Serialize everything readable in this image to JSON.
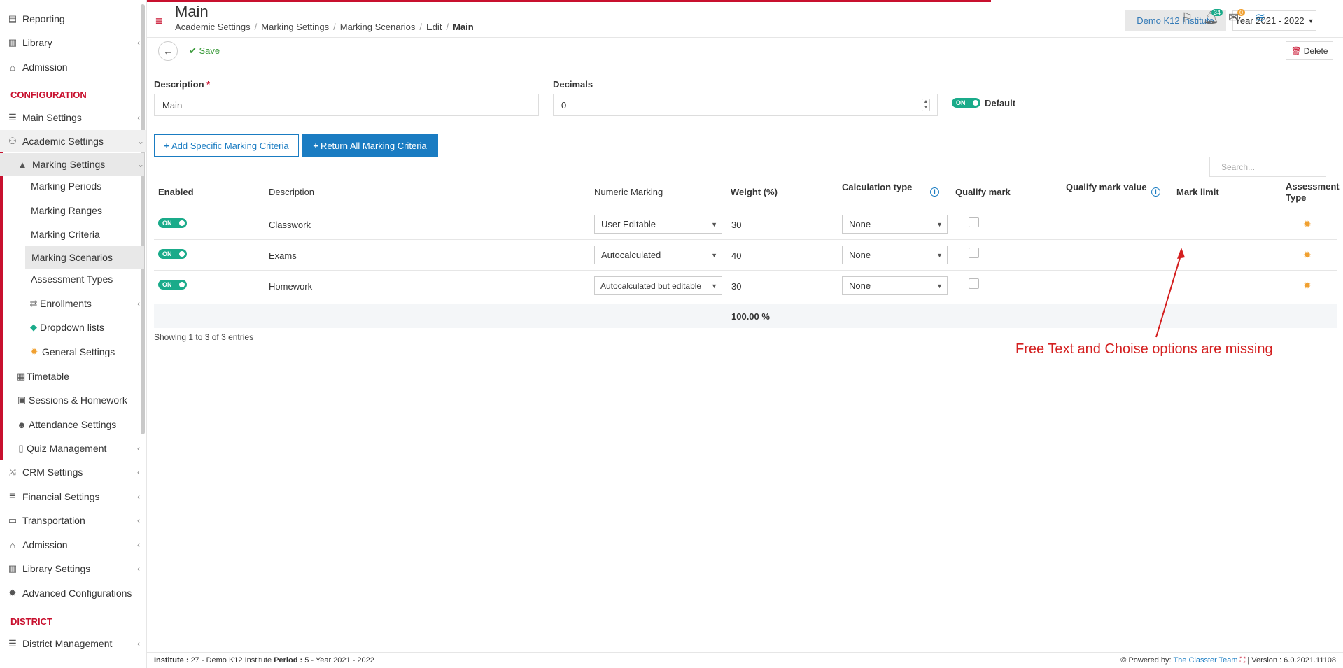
{
  "sidebar": {
    "items": [
      {
        "label": "Reporting",
        "icon": "printer-icon"
      },
      {
        "label": "Library",
        "icon": "books-icon"
      },
      {
        "label": "Admission",
        "icon": "bank-icon"
      },
      {
        "label": "Main Settings",
        "icon": "sliders-icon"
      },
      {
        "label": "Academic Settings",
        "icon": "users-icon"
      },
      {
        "label": "Marking Settings",
        "icon": "graduation-cap-icon"
      },
      {
        "label": "Marking Periods"
      },
      {
        "label": "Marking Ranges"
      },
      {
        "label": "Marking Criteria"
      },
      {
        "label": "Marking Scenarios"
      },
      {
        "label": "Assessment Types"
      },
      {
        "label": "Enrollments",
        "icon": "exchange-icon"
      },
      {
        "label": "Dropdown lists",
        "icon": "layers-icon"
      },
      {
        "label": "General Settings",
        "icon": "gears-icon"
      },
      {
        "label": "Timetable",
        "icon": "calendar-icon"
      },
      {
        "label": "Sessions & Homework",
        "icon": "presentation-icon"
      },
      {
        "label": "Attendance Settings",
        "icon": "user-check-icon"
      },
      {
        "label": "Quiz Management",
        "icon": "clipboard-icon"
      },
      {
        "label": "CRM Settings",
        "icon": "shuffle-icon"
      },
      {
        "label": "Financial Settings",
        "icon": "money-stack-icon"
      },
      {
        "label": "Transportation",
        "icon": "bus-icon"
      },
      {
        "label": "Admission",
        "icon": "bank-icon"
      },
      {
        "label": "Library Settings",
        "icon": "books-icon"
      },
      {
        "label": "Advanced Configurations",
        "icon": "gears-icon"
      },
      {
        "label": "District Management",
        "icon": "list-icon"
      }
    ],
    "sections": {
      "configuration": "CONFIGURATION",
      "district": "DISTRICT"
    }
  },
  "header": {
    "title": "Main",
    "breadcrumb": [
      "Academic Settings",
      "Marking Settings",
      "Marking Scenarios",
      "Edit",
      "Main"
    ],
    "institute": "Demo K12 Institute",
    "year": "Year 2021 - 2022",
    "notif_count": "34",
    "mail_count": "0",
    "user_short": "1 1"
  },
  "toolbar": {
    "save": "Save",
    "delete": "Delete"
  },
  "form": {
    "description_label": "Description",
    "description_value": "Main",
    "decimals_label": "Decimals",
    "decimals_value": "0",
    "default_label": "Default",
    "toggle_on": "ON"
  },
  "buttons": {
    "add_specific": "Add Specific Marking Criteria",
    "return_all": "Return All Marking Criteria"
  },
  "search_placeholder": "Search...",
  "table": {
    "headers": {
      "enabled": "Enabled",
      "description": "Description",
      "numeric": "Numeric Marking",
      "weight": "Weight (%)",
      "calc": "Calculation type",
      "qualify": "Qualify mark",
      "qualify_value": "Qualify mark value",
      "mark_limit": "Mark limit",
      "assess1": "Assessment",
      "assess2": "Type"
    },
    "rows": [
      {
        "enabled": "ON",
        "description": "Classwork",
        "numeric": "User Editable",
        "weight": "30",
        "calc": "None"
      },
      {
        "enabled": "ON",
        "description": "Exams",
        "numeric": "Autocalculated",
        "weight": "40",
        "calc": "None"
      },
      {
        "enabled": "ON",
        "description": "Homework",
        "numeric": "Autocalculated but editable",
        "weight": "30",
        "calc": "None"
      }
    ],
    "total": "100.00 %",
    "showing": "Showing 1 to 3 of 3 entries"
  },
  "annotation": "Free Text and Choise options are missing",
  "footer": {
    "institute_label": "Institute :",
    "institute_value": "27 - Demo K12 Institute",
    "period_label": "Period :",
    "period_value": "5 - Year 2021 - 2022",
    "powered": "Powered by:",
    "team": "The Classter Team",
    "version": "| Version : 6.0.2021.11108"
  },
  "colors": {
    "accent": "#c8102e",
    "primary": "#1a7cc2",
    "toggle": "#1aab8a",
    "annotation": "#d42020"
  }
}
